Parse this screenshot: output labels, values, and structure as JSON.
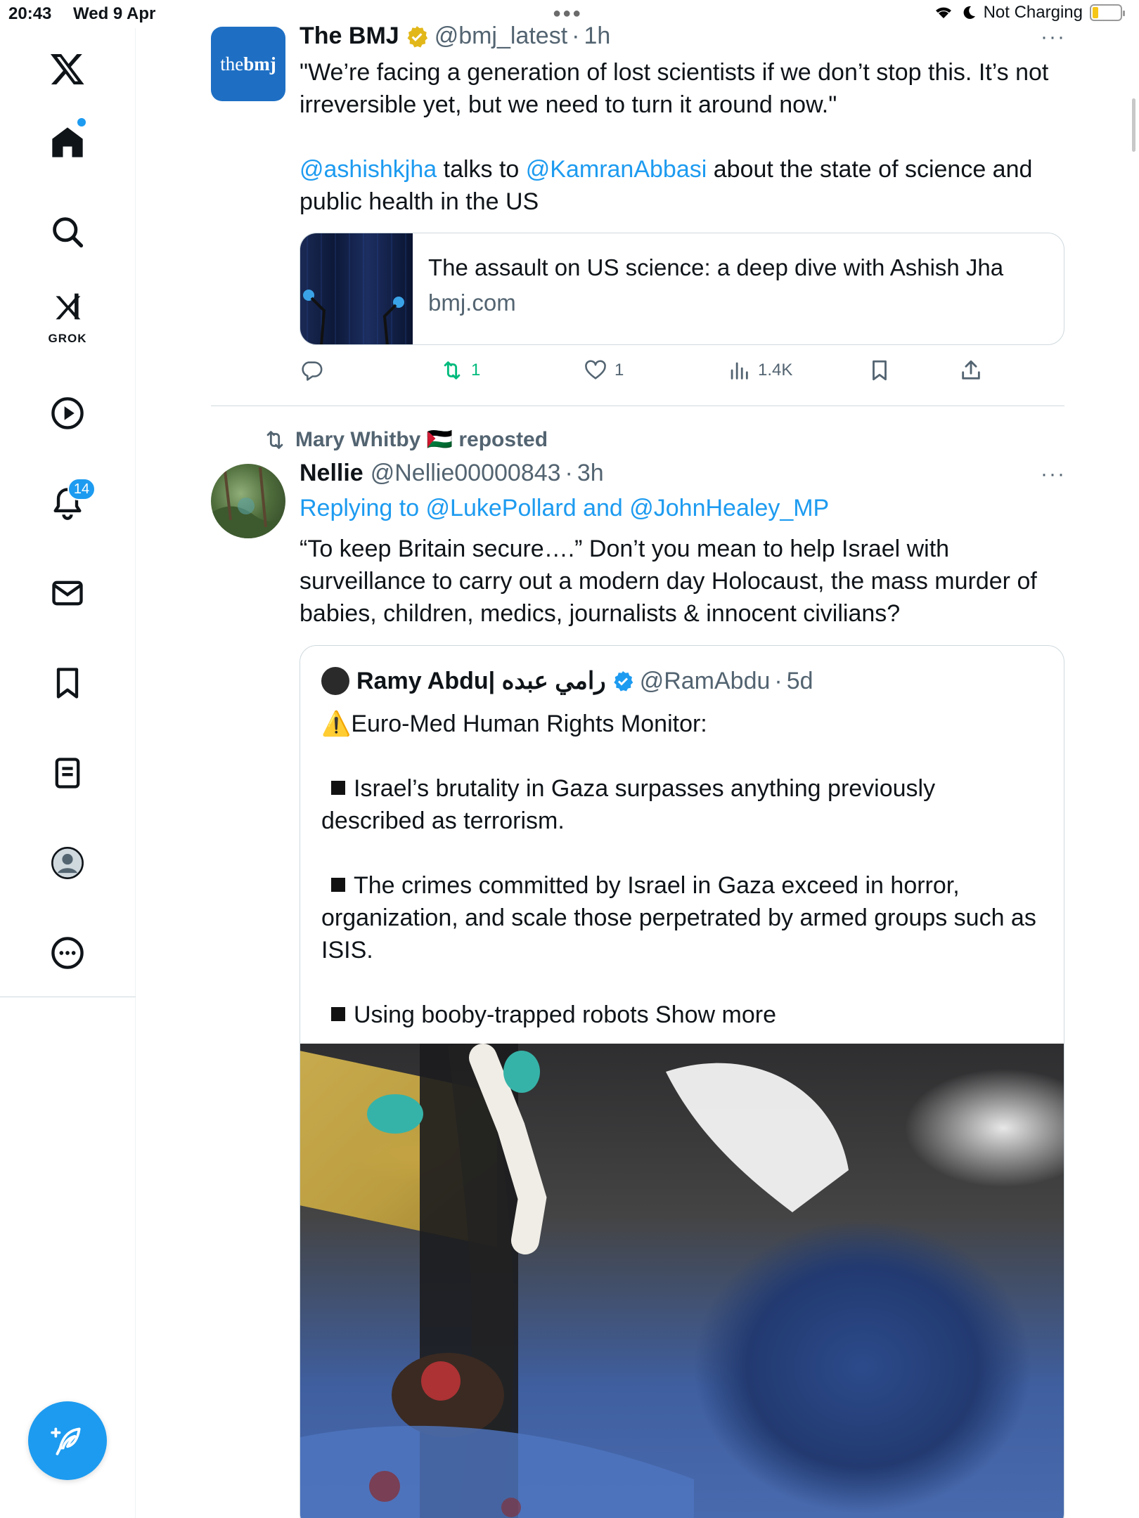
{
  "status_bar": {
    "time": "20:43",
    "date": "Wed 9 Apr",
    "charging": "Not Charging",
    "battery_level": 0.2
  },
  "sidebar": {
    "items": [
      {
        "name": "x-logo",
        "icon": "x-logo-icon"
      },
      {
        "name": "home",
        "icon": "home-icon"
      },
      {
        "name": "search",
        "icon": "search-icon"
      },
      {
        "name": "grok",
        "icon": "grok-icon",
        "label": "GROK"
      },
      {
        "name": "video",
        "icon": "play-icon"
      },
      {
        "name": "notifications",
        "icon": "bell-icon",
        "badge": "14"
      },
      {
        "name": "messages",
        "icon": "mail-icon"
      },
      {
        "name": "bookmarks",
        "icon": "bookmark-icon"
      },
      {
        "name": "lists",
        "icon": "list-icon"
      },
      {
        "name": "profile",
        "icon": "profile-icon"
      },
      {
        "name": "more",
        "icon": "more-icon"
      }
    ],
    "compose_icon": "compose-icon"
  },
  "tweet1": {
    "avatar_text_the": "the",
    "avatar_text_bmj": "bmj",
    "name": "The BMJ",
    "handle": "@bmj_latest",
    "sep": "·",
    "time": "1h",
    "text_line1": "\"We’re facing a generation of lost scientists if we don’t stop this. It’s not",
    "text_line2": "irreversible yet, but we need to turn it around now.\"",
    "mention1": "@ashishkjha",
    "mid_text": " talks to ",
    "mention2": "@KamranAbbasi",
    "text_line3_end": " about the state of science and",
    "text_line4": "public health in the US",
    "card_title": "The assault on US science: a deep dive with Ashish Jha",
    "card_domain": "bmj.com",
    "retweets": "1",
    "likes": "1",
    "views": "1.4K",
    "verified_color": "#e2b719"
  },
  "tweet2": {
    "repost_by": "Mary Whitby 🇵🇸 reposted",
    "name": "Nellie",
    "handle": "@Nellie00000843",
    "sep": "·",
    "time": "3h",
    "replying_to": "Replying to @LukePollard and @JohnHealey_MP",
    "text_line1": "“To keep Britain secure….” Don’t you mean to help Israel with",
    "text_line2": "surveillance to carry out a modern day Holocaust, the mass murder of",
    "text_line3": "babies, children, medics, journalists & innocent civilians?",
    "quote": {
      "name": "Ramy Abdu| رامي عبده",
      "handle": "@RamAbdu",
      "sep": "·",
      "time": "5d",
      "line_warning": "⚠️Euro-Med Human Rights Monitor:",
      "bullet1_a": "Israel’s brutality in Gaza surpasses anything previously",
      "bullet1_b": "described as terrorism.",
      "bullet2_a": "The crimes committed by Israel in Gaza exceed in horror,",
      "bullet2_b": "organization, and scale those perpetrated by armed groups such as",
      "bullet2_c": "ISIS.",
      "bullet3": "Using booby-trapped robots ",
      "show_more": "Show more"
    }
  },
  "colors": {
    "accent": "#1d9bf0",
    "retweet": "#00ba7c",
    "bmj_brand": "#1e6fc4"
  }
}
